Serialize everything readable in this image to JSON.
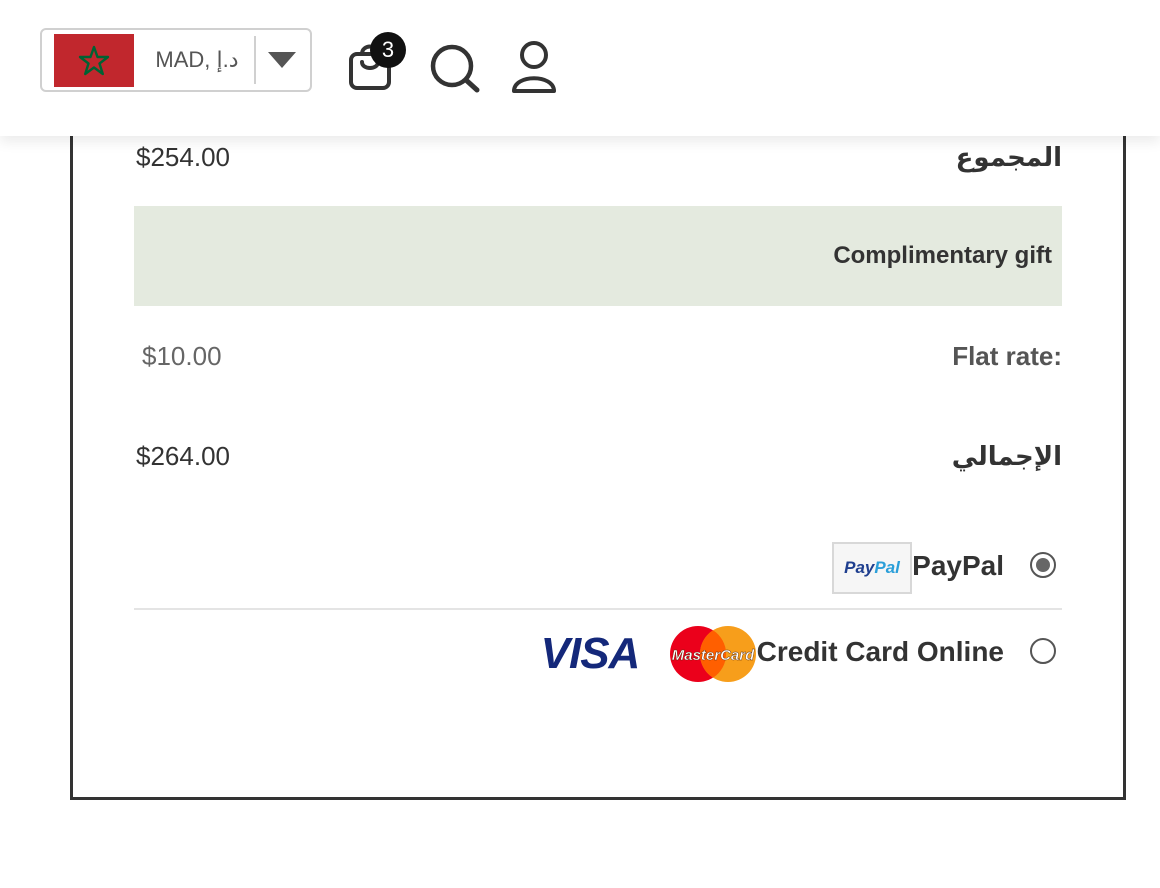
{
  "header": {
    "currency": {
      "label": "MAD, د.إ",
      "flag_color": "#c1272d",
      "star_color": "#006233"
    },
    "cart_count": "3",
    "icons": [
      "shopping-bag-icon",
      "search-icon",
      "user-icon"
    ]
  },
  "summary": {
    "subtotal_label": "المجموع",
    "subtotal_value": "$254.00",
    "gift_label": "Complimentary gift",
    "shipping_label": "Flat rate:",
    "shipping_value": "$10.00",
    "total_label": "الإجمالي",
    "total_value": "$264.00"
  },
  "payment": {
    "methods": [
      {
        "label": "PayPal",
        "selected": true,
        "logo_text_1": "Pay",
        "logo_text_2": "Pal"
      },
      {
        "label": "Credit Card Online",
        "selected": false,
        "mastercard_text": "MasterCard",
        "visa_text": "VISA"
      }
    ]
  },
  "colors": {
    "gift_bg": "#e4eadf",
    "border": "#333333",
    "visa_blue": "#14287a",
    "mc_red": "#eb001b",
    "mc_orange": "#f79e1b"
  }
}
